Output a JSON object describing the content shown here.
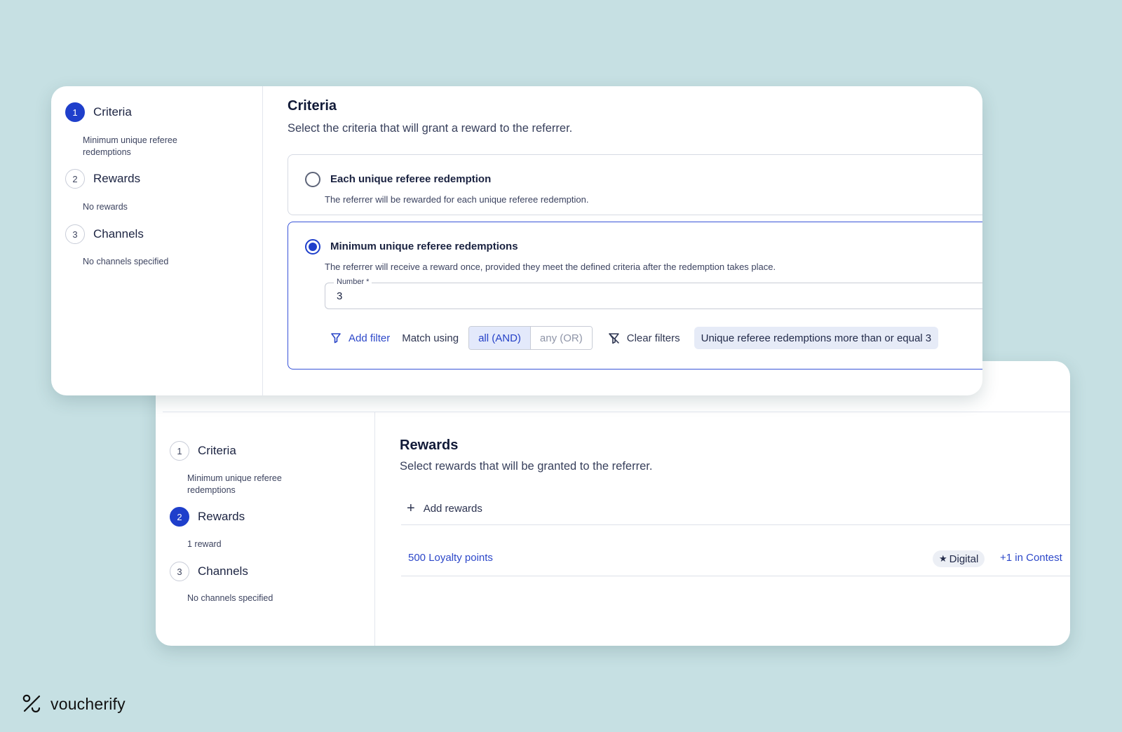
{
  "criteria_card": {
    "steps": [
      {
        "number": "1",
        "label": "Criteria",
        "sub": "Minimum unique referee redemptions",
        "active": true
      },
      {
        "number": "2",
        "label": "Rewards",
        "sub": "No rewards",
        "active": false
      },
      {
        "number": "3",
        "label": "Channels",
        "sub": "No channels specified",
        "active": false
      }
    ],
    "title": "Criteria",
    "description": "Select the criteria that will grant a reward to the referrer.",
    "options": [
      {
        "title": "Each unique referee redemption",
        "description": "The referrer will be rewarded for each unique referee redemption.",
        "selected": false
      },
      {
        "title": "Minimum unique referee redemptions",
        "description": "The referrer will receive a reward once, provided they meet the defined criteria after the redemption takes place.",
        "selected": true
      }
    ],
    "number_field": {
      "label": "Number *",
      "value": "3"
    },
    "filters": {
      "add_filter_label": "Add filter",
      "match_label": "Match using",
      "match_options": [
        "all (AND)",
        "any (OR)"
      ],
      "match_selected": "all (AND)",
      "clear_label": "Clear filters",
      "active_filter": "Unique referee redemptions more than or equal 3"
    }
  },
  "rewards_card": {
    "steps": [
      {
        "number": "1",
        "label": "Criteria",
        "sub": "Minimum unique referee redemptions",
        "active": false
      },
      {
        "number": "2",
        "label": "Rewards",
        "sub": "1 reward",
        "active": true
      },
      {
        "number": "3",
        "label": "Channels",
        "sub": "No channels specified",
        "active": false
      }
    ],
    "title": "Rewards",
    "description": "Select rewards that will be granted to the referrer.",
    "add_rewards_label": "Add rewards",
    "rewards": [
      {
        "name": "500 Loyalty points",
        "badge": "Digital",
        "badge_icon": "star-icon",
        "extra": "+1 in Contest"
      }
    ]
  },
  "brand": {
    "name": "voucherify",
    "logo_icon": "percent-logo-icon"
  },
  "colors": {
    "accent": "#1f3fcb",
    "background": "#c6e0e3",
    "link": "#2d48c9"
  }
}
